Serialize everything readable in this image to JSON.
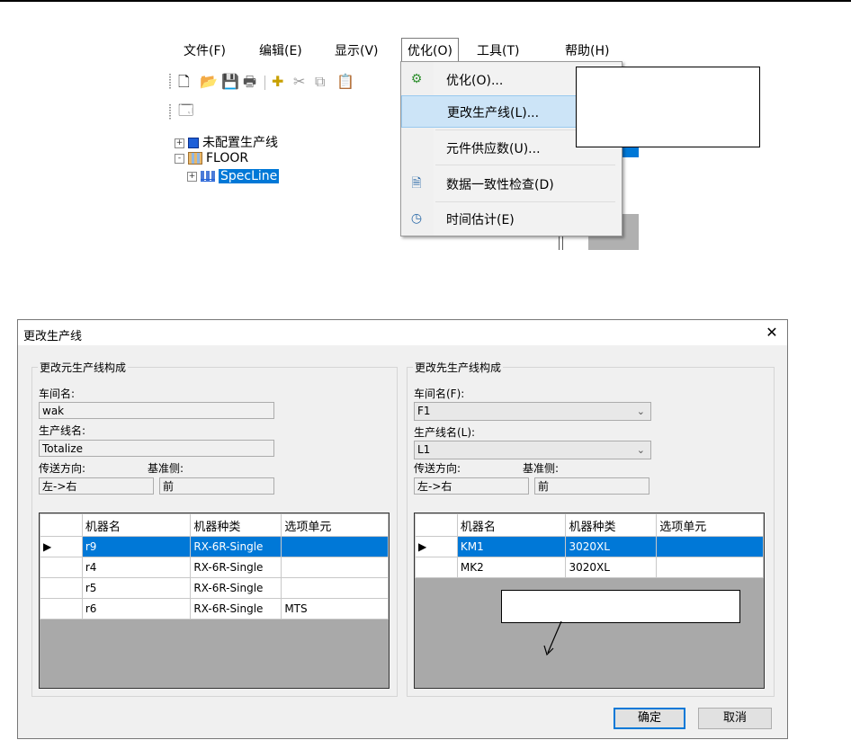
{
  "menu": {
    "items": [
      "文件(F)",
      "编辑(E)",
      "显示(V)",
      "优化(O)",
      "工具(T)",
      "帮助(H)"
    ],
    "active_index": 3
  },
  "tree": [
    {
      "label": "未配置生产线",
      "expander": "+"
    },
    {
      "label": "FLOOR",
      "expander": "-"
    },
    {
      "label": "SpecLine",
      "expander": "+",
      "selected": true
    }
  ],
  "dropdown": {
    "items": [
      {
        "label": "优化(O)...",
        "icon": "optimize-icon"
      },
      {
        "label": "更改生产线(L)...",
        "icon": "",
        "highlighted": true
      },
      {
        "label": "元件供应数(U)...",
        "icon": ""
      },
      {
        "label": "数据一致性检查(D)",
        "icon": "check-icon"
      },
      {
        "label": "时间估计(E)",
        "icon": "clock-icon"
      }
    ]
  },
  "dialog": {
    "title": "更改生产线",
    "close": "✕",
    "source": {
      "group_title": "更改元生产线构成",
      "floor_label": "车间名:",
      "floor_value": "wak",
      "line_label": "生产线名:",
      "line_value": "Totalize",
      "direction_label": "传送方向:",
      "direction_value": "左->右",
      "base_label": "基准侧:",
      "base_value": "前",
      "columns": [
        "机器名",
        "机器种类",
        "选项单元"
      ],
      "rows": [
        [
          "r9",
          "RX-6R-Single",
          ""
        ],
        [
          "r4",
          "RX-6R-Single",
          ""
        ],
        [
          "r5",
          "RX-6R-Single",
          ""
        ],
        [
          "r6",
          "RX-6R-Single",
          "MTS"
        ]
      ]
    },
    "target": {
      "group_title": "更改先生产线构成",
      "floor_label": "车间名(F):",
      "floor_value": "F1",
      "line_label": "生产线名(L):",
      "line_value": "L1",
      "direction_label": "传送方向:",
      "direction_value": "左->右",
      "base_label": "基准侧:",
      "base_value": "前",
      "columns": [
        "机器名",
        "机器种类",
        "选项单元"
      ],
      "rows": [
        [
          "KM1",
          "3020XL",
          ""
        ],
        [
          "MK2",
          "3020XL",
          ""
        ]
      ]
    },
    "ok_label": "确定",
    "cancel_label": "取消"
  }
}
